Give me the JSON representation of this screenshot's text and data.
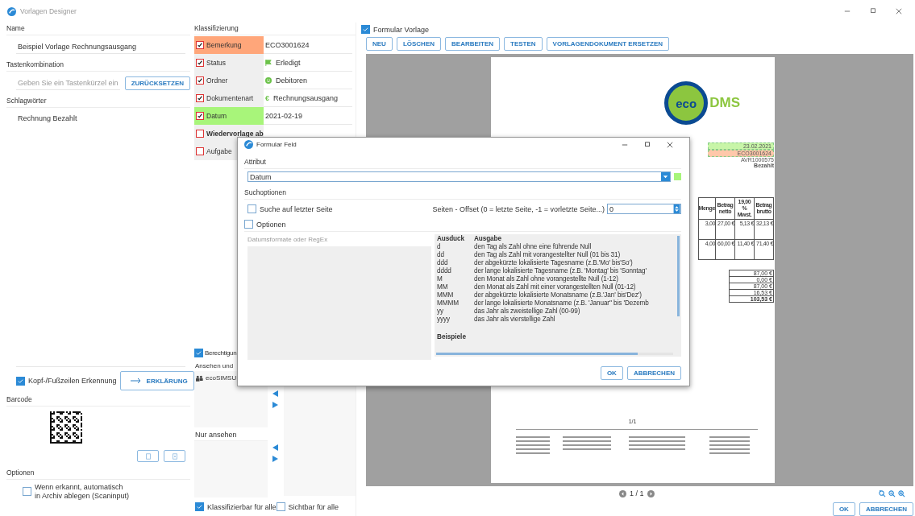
{
  "window": {
    "title": "Vorlagen Designer"
  },
  "left": {
    "name_label": "Name",
    "name_value": "Beispiel Vorlage Rechnungsausgang",
    "shortcut_label": "Tastenkombination",
    "shortcut_placeholder": "Geben Sie ein Tastenkürzel ein",
    "reset_button": "ZURÜCKSETZEN",
    "keywords_label": "Schlagwörter",
    "keywords": "Rechnung Bezahlt",
    "header_detection": {
      "label": "Kopf-/Fußzeilen Erkennung",
      "checked": true
    },
    "explain_button": "ERKLÄRUNG",
    "barcode_label": "Barcode",
    "options_label": "Optionen",
    "auto_archive": {
      "lines": [
        "Wenn erkannt, automatisch",
        "in Archiv ablegen (Scaninput)"
      ],
      "checked": false
    }
  },
  "classification": {
    "title": "Klassifizierung",
    "rows": [
      {
        "label": "Bemerkung",
        "checked": true,
        "bold": false,
        "color": "#ffa67a",
        "kind": "text",
        "value": "ECO3001624"
      },
      {
        "label": "Status",
        "checked": true,
        "bold": false,
        "color": "#efefef",
        "kind": "flag",
        "value": "Erledigt"
      },
      {
        "label": "Ordner",
        "checked": true,
        "bold": false,
        "color": "#efefef",
        "kind": "smiley",
        "value": "Debitoren"
      },
      {
        "label": "Dokumentenart",
        "checked": true,
        "bold": false,
        "color": "#efefef",
        "kind": "symbol",
        "symbol": "€",
        "value": "Rechnungsausgang"
      },
      {
        "label": "Datum",
        "checked": true,
        "bold": false,
        "color": "#a8f57a",
        "kind": "text",
        "value": "2021-02-19"
      },
      {
        "label": "Wiedervorlage ab",
        "checked": false,
        "bold": true,
        "color": "#efefef",
        "kind": "empty"
      },
      {
        "label": "Aufgabe",
        "checked": false,
        "bold": false,
        "color": "#efefef",
        "kind": "none"
      }
    ]
  },
  "permissions": {
    "label": "Berechtigun",
    "checked": true,
    "view_classify_label": "Ansehen und",
    "users": [
      "ecoSIMSU"
    ],
    "view_only_label": "Nur ansehen",
    "classify_all": {
      "label": "Klassifizierbar für alle",
      "checked": true
    },
    "visible_all": {
      "label": "Sichtbar für alle",
      "checked": false
    }
  },
  "template": {
    "label": "Formular Vorlage",
    "checked": true,
    "buttons": [
      "NEU",
      "LÖSCHEN",
      "BEARBEITEN",
      "TESTEN",
      "VORLAGENDOKUMENT ERSETZEN"
    ],
    "page_indicator": "1 / 1"
  },
  "document": {
    "logo_left": "eco",
    "logo_right": "DMS",
    "fields": [
      {
        "text": "23.02.2021",
        "color": "#c8f5a8"
      },
      {
        "text": "ECO3001624",
        "color": "#ffc8aa"
      }
    ],
    "lines": [
      "AVR1000575",
      "Bezahlt"
    ],
    "table": {
      "columns": [
        "Menge",
        "Betrag netto",
        "19,00 % Mwst.",
        "Betrag brutto"
      ],
      "rows": [
        [
          "3,00",
          "27,00 €",
          "5,13 €",
          "32,13 €"
        ],
        [
          "4,00",
          "60,00 €",
          "11,40 €",
          "71,40 €"
        ]
      ]
    },
    "totals": [
      "87,00 €",
      "0,00 €",
      "87,00 €",
      "16,53 €",
      "103,53 €"
    ],
    "page_number": "1/1"
  },
  "footer_buttons": [
    "OK",
    "ABBRECHEN"
  ],
  "dialog": {
    "title": "Formular Feld",
    "attribute_label": "Attribut",
    "attribute_value": "Datum",
    "search_options_label": "Suchoptionen",
    "last_page": {
      "label": "Suche auf letzter Seite",
      "checked": false
    },
    "offset_label": "Seiten - Offset (0 = letzte Seite, -1 = vorletzte Seite...)",
    "offset_value": "0",
    "options": {
      "label": "Optionen",
      "checked": false
    },
    "regex_label": "Datumsformate oder RegEx",
    "help": {
      "headers": [
        "Ausduck",
        "Ausgabe"
      ],
      "rows": [
        [
          "d",
          "den Tag als Zahl ohne eine führende Null"
        ],
        [
          "dd",
          "den Tag als Zahl mit vorangestellter Null (01 bis 31)"
        ],
        [
          "ddd",
          "der abgekürzte lokalisierte Tagesname (z.B.'Mo' bis'So')"
        ],
        [
          "dddd",
          "der lange lokalisierte Tagesname (z.B. 'Montag' bis 'Sonntag'"
        ],
        [
          "M",
          "den Monat als Zahl ohne vorangestellte Null (1-12)"
        ],
        [
          "MM",
          "den Monat als Zahl mit einer vorangestellten Null (01-12)"
        ],
        [
          "MMM",
          "der abgekürzte lokalisierte Monatsname (z.B.'Jan' bis'Dez')"
        ],
        [
          "MMMM",
          "der lange lokalisierte Monatsname (z.B. 'Januar'' bis 'Dezemb"
        ],
        [
          "yy",
          "das Jahr als zweistellige Zahl (00-99)"
        ],
        [
          "yyyy",
          "das Jahr als vierstellige Zahl"
        ]
      ],
      "examples_label": "Beispiele"
    },
    "buttons": [
      "OK",
      "ABBRECHEN"
    ]
  }
}
